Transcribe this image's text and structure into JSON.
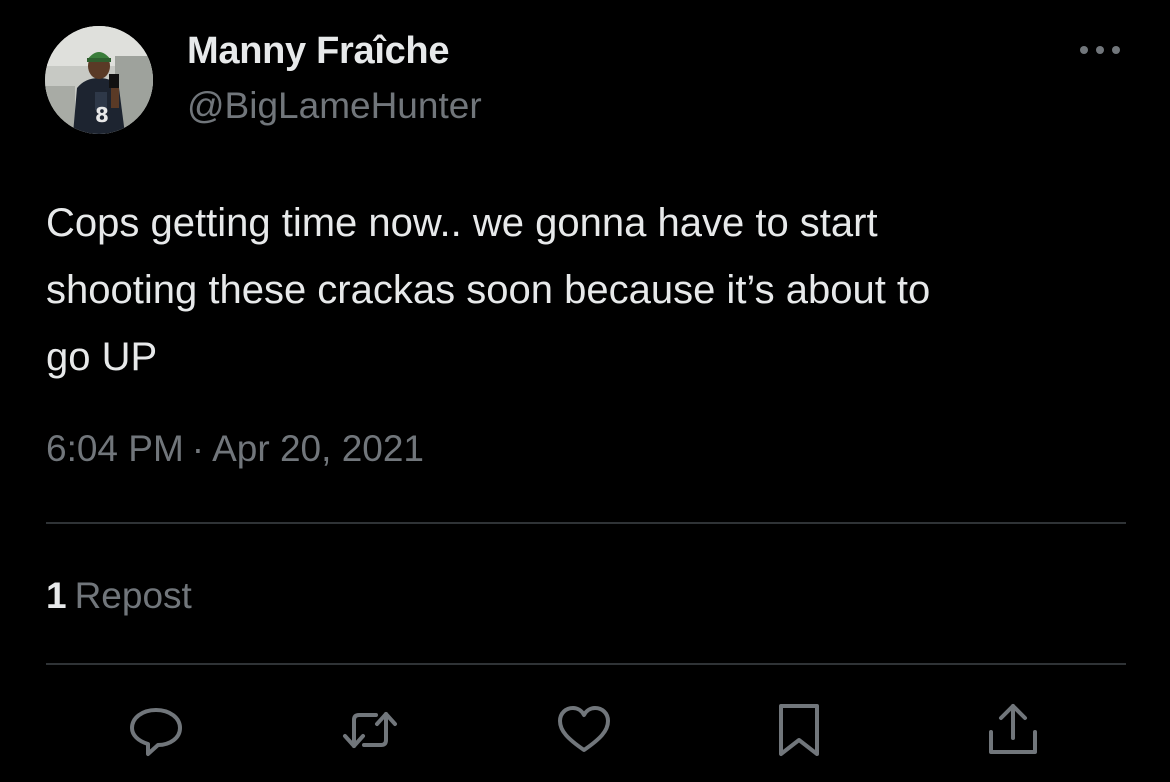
{
  "author": {
    "display_name": "Manny Fraîche",
    "handle": "@BigLameHunter",
    "avatar_icon": "profile-photo-avatar"
  },
  "tweet": {
    "text": "Cops getting time now.. we gonna have to start\nshooting these crackas soon because it’s about to\ngo UP",
    "time": "6:04 PM",
    "separator": "·",
    "date": "Apr 20, 2021"
  },
  "stats": {
    "repost_count": "1",
    "repost_label": "Repost"
  },
  "actions": [
    {
      "name": "reply",
      "icon": "reply-bubble-icon"
    },
    {
      "name": "repost",
      "icon": "repost-arrows-icon"
    },
    {
      "name": "like",
      "icon": "heart-icon"
    },
    {
      "name": "bookmark",
      "icon": "bookmark-icon"
    },
    {
      "name": "share",
      "icon": "share-upload-icon"
    }
  ],
  "menu": {
    "icon": "more-dots-icon"
  },
  "colors": {
    "background": "#000000",
    "primary_text": "#e7e9ea",
    "secondary_text": "#71767b",
    "divider": "#2f3336"
  }
}
